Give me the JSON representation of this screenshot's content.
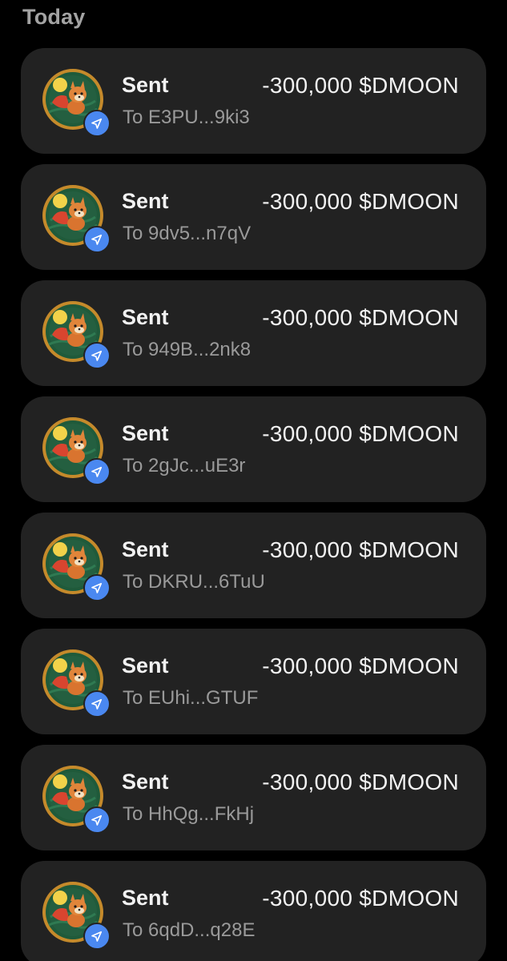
{
  "section": {
    "title": "Today"
  },
  "transactions": [
    {
      "type": "Sent",
      "amount": "-300,000 $DMOON",
      "recipient": "To E3PU...9ki3",
      "token_icon": "dmoon-token-icon",
      "badge_icon": "send-icon"
    },
    {
      "type": "Sent",
      "amount": "-300,000 $DMOON",
      "recipient": "To 9dv5...n7qV",
      "token_icon": "dmoon-token-icon",
      "badge_icon": "send-icon"
    },
    {
      "type": "Sent",
      "amount": "-300,000 $DMOON",
      "recipient": "To 949B...2nk8",
      "token_icon": "dmoon-token-icon",
      "badge_icon": "send-icon"
    },
    {
      "type": "Sent",
      "amount": "-300,000 $DMOON",
      "recipient": "To 2gJc...uE3r",
      "token_icon": "dmoon-token-icon",
      "badge_icon": "send-icon"
    },
    {
      "type": "Sent",
      "amount": "-300,000 $DMOON",
      "recipient": "To DKRU...6TuU",
      "token_icon": "dmoon-token-icon",
      "badge_icon": "send-icon"
    },
    {
      "type": "Sent",
      "amount": "-300,000 $DMOON",
      "recipient": "To EUhi...GTUF",
      "token_icon": "dmoon-token-icon",
      "badge_icon": "send-icon"
    },
    {
      "type": "Sent",
      "amount": "-300,000 $DMOON",
      "recipient": "To HhQg...FkHj",
      "token_icon": "dmoon-token-icon",
      "badge_icon": "send-icon"
    },
    {
      "type": "Sent",
      "amount": "-300,000 $DMOON",
      "recipient": "To 6qdD...q28E",
      "token_icon": "dmoon-token-icon",
      "badge_icon": "send-icon"
    }
  ],
  "colors": {
    "background": "#000000",
    "card": "#222222",
    "badge": "#4a88f0",
    "avatar_ring": "#c58a2b",
    "avatar_bg": "#1f5a3a"
  }
}
